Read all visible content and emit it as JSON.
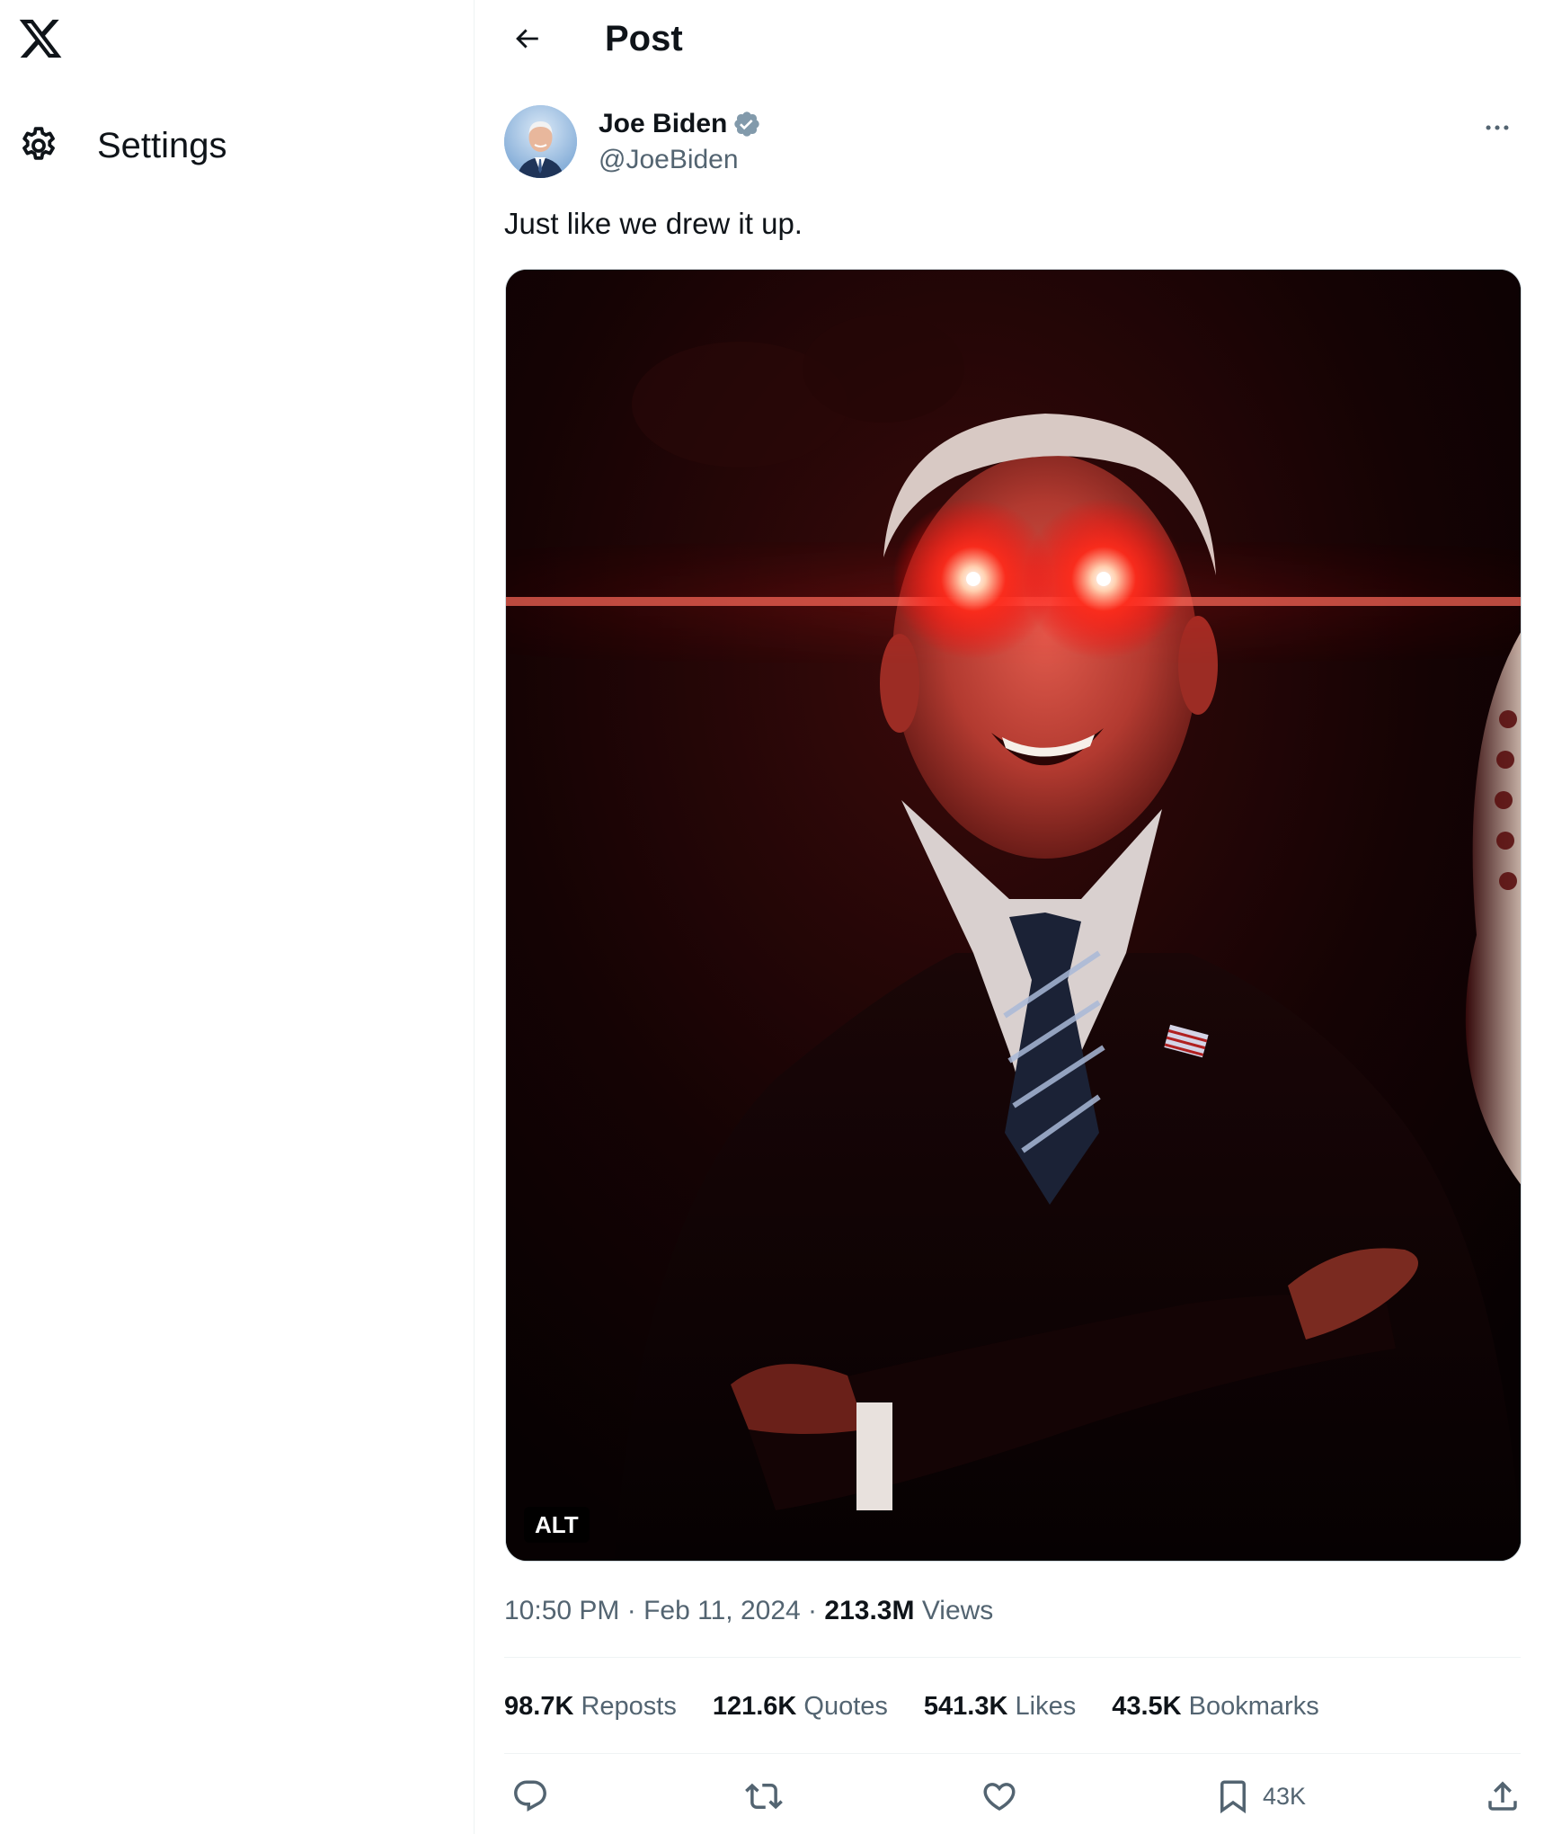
{
  "nav": {
    "logo_icon": "x-logo-icon",
    "settings_label": "Settings",
    "settings_icon": "gear-icon"
  },
  "header": {
    "title": "Post",
    "back_icon": "back-arrow-icon"
  },
  "post": {
    "author_name": "Joe Biden",
    "author_handle": "@JoeBiden",
    "verified_icon": "verified-badge-icon",
    "verified_color": "#829aab",
    "text": "Just like we drew it up.",
    "media_alt_badge": "ALT",
    "time": "10:50 PM",
    "separator": "·",
    "date": "Feb 11, 2024",
    "views_count": "213.3M",
    "views_label": "Views"
  },
  "stats": [
    {
      "num": "98.7K",
      "label": "Reposts"
    },
    {
      "num": "121.6K",
      "label": "Quotes"
    },
    {
      "num": "541.3K",
      "label": "Likes"
    },
    {
      "num": "43.5K",
      "label": "Bookmarks"
    }
  ],
  "actions": {
    "reply_icon": "reply-icon",
    "repost_icon": "repost-icon",
    "like_icon": "heart-icon",
    "bookmark_icon": "bookmark-icon",
    "bookmark_count": "43K",
    "share_icon": "share-icon"
  },
  "colors": {
    "text_primary": "#0f1419",
    "text_secondary": "#536471",
    "divider": "#eff3f4",
    "laser_red": "#ff1a1a"
  }
}
